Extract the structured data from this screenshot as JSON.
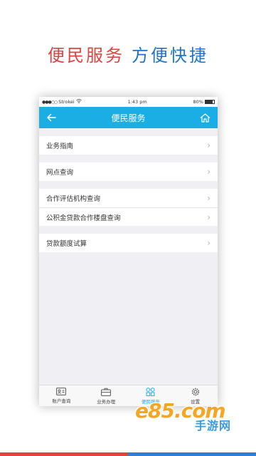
{
  "headline": {
    "part1": "便民服务",
    "part2": "方便快捷"
  },
  "statusbar": {
    "carrier": "Strokei",
    "time": "1:43 pm",
    "battery": "80%"
  },
  "navbar": {
    "title": "便民服务"
  },
  "groups": [
    {
      "items": [
        {
          "label": "业务指南"
        }
      ]
    },
    {
      "items": [
        {
          "label": "网点查询"
        }
      ]
    },
    {
      "items": [
        {
          "label": "合作评估机构查询"
        },
        {
          "label": "公积金贷款合作楼盘查询"
        }
      ]
    },
    {
      "items": [
        {
          "label": "贷款额度试算"
        }
      ]
    }
  ],
  "tabbar": {
    "tabs": [
      {
        "label": "账户查询",
        "icon": "id-card-icon"
      },
      {
        "label": "业务办理",
        "icon": "briefcase-icon"
      },
      {
        "label": "便民服务",
        "icon": "grid-icon",
        "active": true
      },
      {
        "label": "设置",
        "icon": "gear-icon"
      }
    ]
  },
  "watermark": {
    "logo": "e85.com",
    "sub": "手游网"
  },
  "colors": {
    "accent": "#1aaee5",
    "red": "#e0433f",
    "blue": "#1d74c9",
    "watermark_orange": "#f6a623"
  }
}
